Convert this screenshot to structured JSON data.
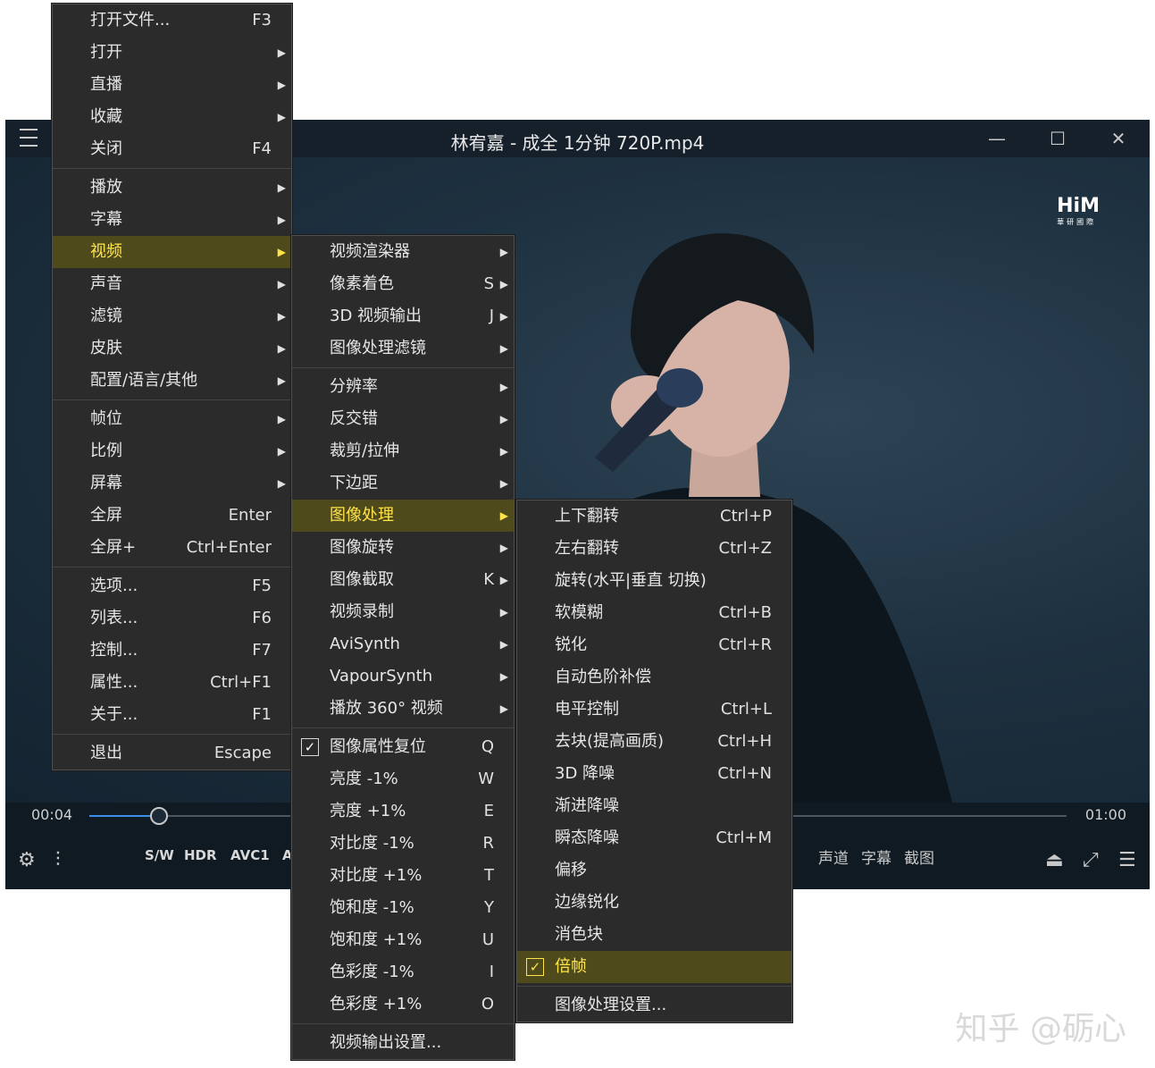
{
  "player": {
    "title": "林宥嘉 - 成全 1分钟 720P.mp4",
    "logo": {
      "text": "HiM",
      "subtext": "華研國際"
    },
    "time_current": "00:04",
    "time_total": "01:00",
    "progress": 0.07,
    "tags": [
      "S/W",
      "HDR",
      "AVC1",
      "A"
    ],
    "right_labels": [
      "声道",
      "字幕",
      "截图"
    ]
  },
  "menu1": {
    "items": [
      {
        "label": "打开文件...",
        "shortcut": "F3"
      },
      {
        "label": "打开",
        "submenu": true
      },
      {
        "label": "直播",
        "submenu": true
      },
      {
        "label": "收藏",
        "submenu": true
      },
      {
        "label": "关闭",
        "shortcut": "F4"
      },
      {
        "separator": true
      },
      {
        "label": "播放",
        "submenu": true
      },
      {
        "label": "字幕",
        "submenu": true
      },
      {
        "label": "视频",
        "submenu": true,
        "highlighted": true
      },
      {
        "label": "声音",
        "submenu": true
      },
      {
        "label": "滤镜",
        "submenu": true
      },
      {
        "label": "皮肤",
        "submenu": true
      },
      {
        "label": "配置/语言/其他",
        "submenu": true
      },
      {
        "separator": true
      },
      {
        "label": "帧位",
        "submenu": true
      },
      {
        "label": "比例",
        "submenu": true
      },
      {
        "label": "屏幕",
        "submenu": true
      },
      {
        "label": "全屏",
        "shortcut": "Enter"
      },
      {
        "label": "全屏+",
        "shortcut": "Ctrl+Enter"
      },
      {
        "separator": true
      },
      {
        "label": "选项...",
        "shortcut": "F5"
      },
      {
        "label": "列表...",
        "shortcut": "F6"
      },
      {
        "label": "控制...",
        "shortcut": "F7"
      },
      {
        "label": "属性...",
        "shortcut": "Ctrl+F1"
      },
      {
        "label": "关于...",
        "shortcut": "F1"
      },
      {
        "separator": true
      },
      {
        "label": "退出",
        "shortcut": "Escape"
      }
    ]
  },
  "menu2": {
    "items": [
      {
        "label": "视频渲染器",
        "submenu": true
      },
      {
        "label": "像素着色",
        "shortcut": "S",
        "submenu": true
      },
      {
        "label": "3D 视频输出",
        "shortcut": "J",
        "submenu": true
      },
      {
        "label": "图像处理滤镜",
        "submenu": true
      },
      {
        "separator": true
      },
      {
        "label": "分辨率",
        "submenu": true
      },
      {
        "label": "反交错",
        "submenu": true
      },
      {
        "label": "裁剪/拉伸",
        "submenu": true
      },
      {
        "label": "下边距",
        "submenu": true
      },
      {
        "label": "图像处理",
        "submenu": true,
        "highlighted": true
      },
      {
        "label": "图像旋转",
        "submenu": true
      },
      {
        "label": "图像截取",
        "shortcut": "K",
        "submenu": true
      },
      {
        "label": "视频录制",
        "submenu": true
      },
      {
        "label": "AviSynth",
        "submenu": true
      },
      {
        "label": "VapourSynth",
        "submenu": true
      },
      {
        "label": "播放 360° 视频",
        "submenu": true
      },
      {
        "separator": true
      },
      {
        "label": "图像属性复位",
        "shortcut": "Q",
        "checked": true
      },
      {
        "label": "亮度 -1%",
        "shortcut": "W"
      },
      {
        "label": "亮度 +1%",
        "shortcut": "E"
      },
      {
        "label": "对比度 -1%",
        "shortcut": "R"
      },
      {
        "label": "对比度 +1%",
        "shortcut": "T"
      },
      {
        "label": "饱和度 -1%",
        "shortcut": "Y"
      },
      {
        "label": "饱和度 +1%",
        "shortcut": "U"
      },
      {
        "label": "色彩度 -1%",
        "shortcut": "I"
      },
      {
        "label": "色彩度 +1%",
        "shortcut": "O"
      },
      {
        "separator": true
      },
      {
        "label": "视频输出设置..."
      }
    ]
  },
  "menu3": {
    "items": [
      {
        "label": "上下翻转",
        "shortcut": "Ctrl+P"
      },
      {
        "label": "左右翻转",
        "shortcut": "Ctrl+Z"
      },
      {
        "label": "旋转(水平|垂直 切换)"
      },
      {
        "label": "软模糊",
        "shortcut": "Ctrl+B"
      },
      {
        "label": "锐化",
        "shortcut": "Ctrl+R"
      },
      {
        "label": "自动色阶补偿"
      },
      {
        "label": "电平控制",
        "shortcut": "Ctrl+L"
      },
      {
        "label": "去块(提高画质)",
        "shortcut": "Ctrl+H"
      },
      {
        "label": "3D 降噪",
        "shortcut": "Ctrl+N"
      },
      {
        "label": "渐进降噪"
      },
      {
        "label": "瞬态降噪",
        "shortcut": "Ctrl+M"
      },
      {
        "label": "偏移"
      },
      {
        "label": "边缘锐化"
      },
      {
        "label": "消色块"
      },
      {
        "label": "倍帧",
        "checked": true,
        "highlighted": true
      },
      {
        "separator": true
      },
      {
        "label": "图像处理设置..."
      }
    ]
  },
  "watermark": "知乎 @砺心"
}
